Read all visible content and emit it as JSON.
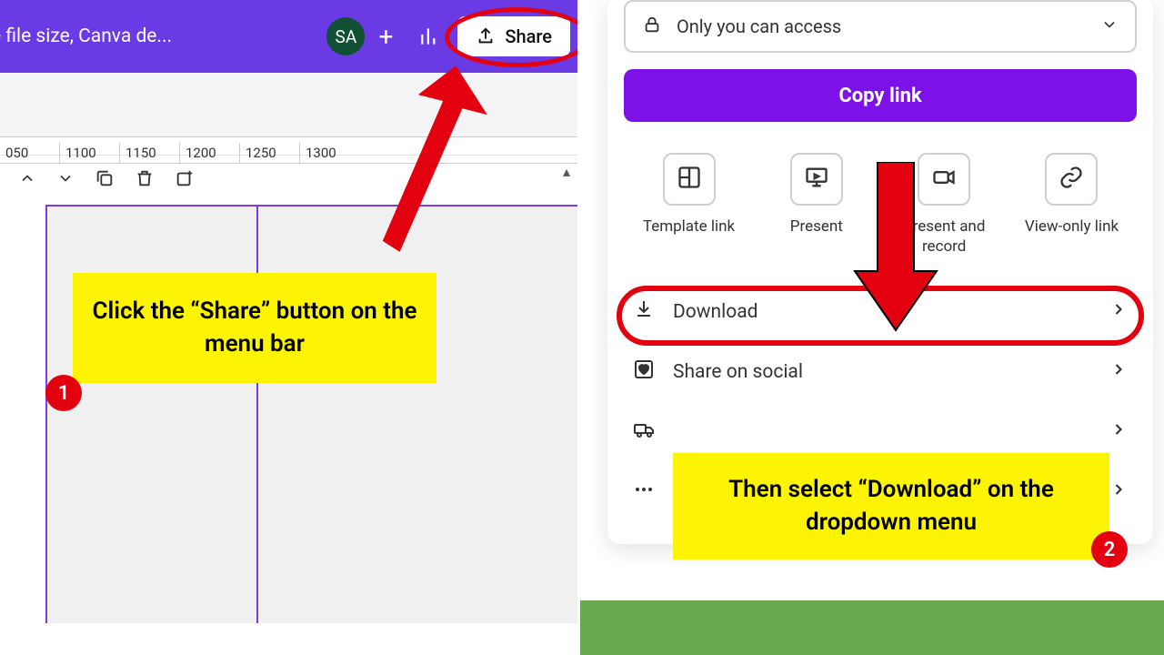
{
  "topbar": {
    "title_fragment": "e file size, Canva de...",
    "avatar_initials": "SA",
    "share_label": "Share"
  },
  "ruler": {
    "ticks": [
      "050",
      "1100",
      "1150",
      "1200",
      "1250",
      "1300"
    ]
  },
  "callouts": {
    "one": "Click the “Share” button on the menu bar",
    "one_badge": "1",
    "two": "Then select “Download” on the dropdown menu",
    "two_badge": "2"
  },
  "share_panel": {
    "access_text": "Only you can access",
    "copy_link": "Copy link",
    "tiles": [
      {
        "label": "Template link"
      },
      {
        "label": "Present"
      },
      {
        "label": "Present and record"
      },
      {
        "label": "View-only link"
      }
    ],
    "menu": [
      {
        "label": "Download"
      },
      {
        "label": "Share on social"
      },
      {
        "label": ""
      },
      {
        "label": ""
      }
    ]
  }
}
